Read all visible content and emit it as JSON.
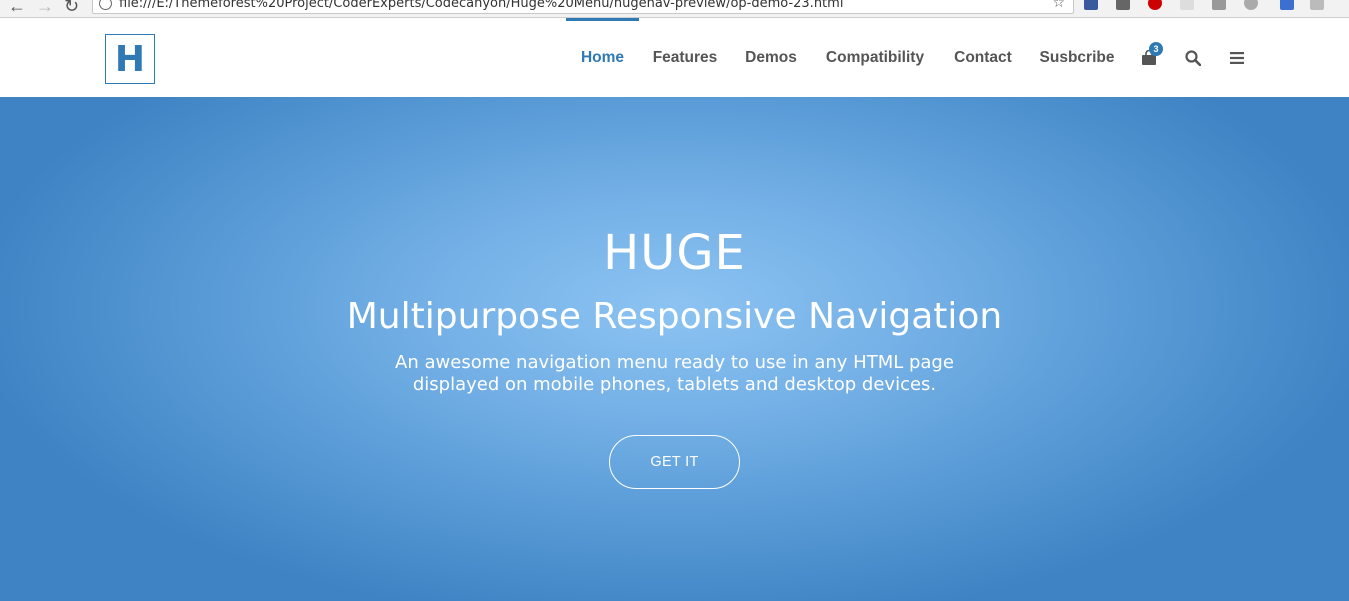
{
  "browser": {
    "url": "file:///E:/Themeforest%20Project/CoderExperts/Codecanyon/Huge%20Menu/hugenav-preview/op-demo-23.html"
  },
  "header": {
    "logo_letter": "H",
    "nav": [
      {
        "label": "Home",
        "active": true
      },
      {
        "label": "Features",
        "active": false
      },
      {
        "label": "Demos",
        "active": false
      },
      {
        "label": "Compatibility",
        "active": false
      },
      {
        "label": "Contact",
        "active": false
      },
      {
        "label": "Susbcribe",
        "active": false
      }
    ],
    "cart_count": "3",
    "icons": [
      "shopping-bag-icon",
      "search-icon",
      "hamburger-menu-icon"
    ],
    "accent_color": "#2f79b5"
  },
  "hero": {
    "title": "HUGE",
    "subtitle": "Multipurpose Responsive Navigation",
    "description": "An awesome navigation menu ready to use in any HTML page displayed on mobile phones, tablets and desktop devices.",
    "cta_label": "GET IT",
    "background_color": "#5598d4"
  }
}
